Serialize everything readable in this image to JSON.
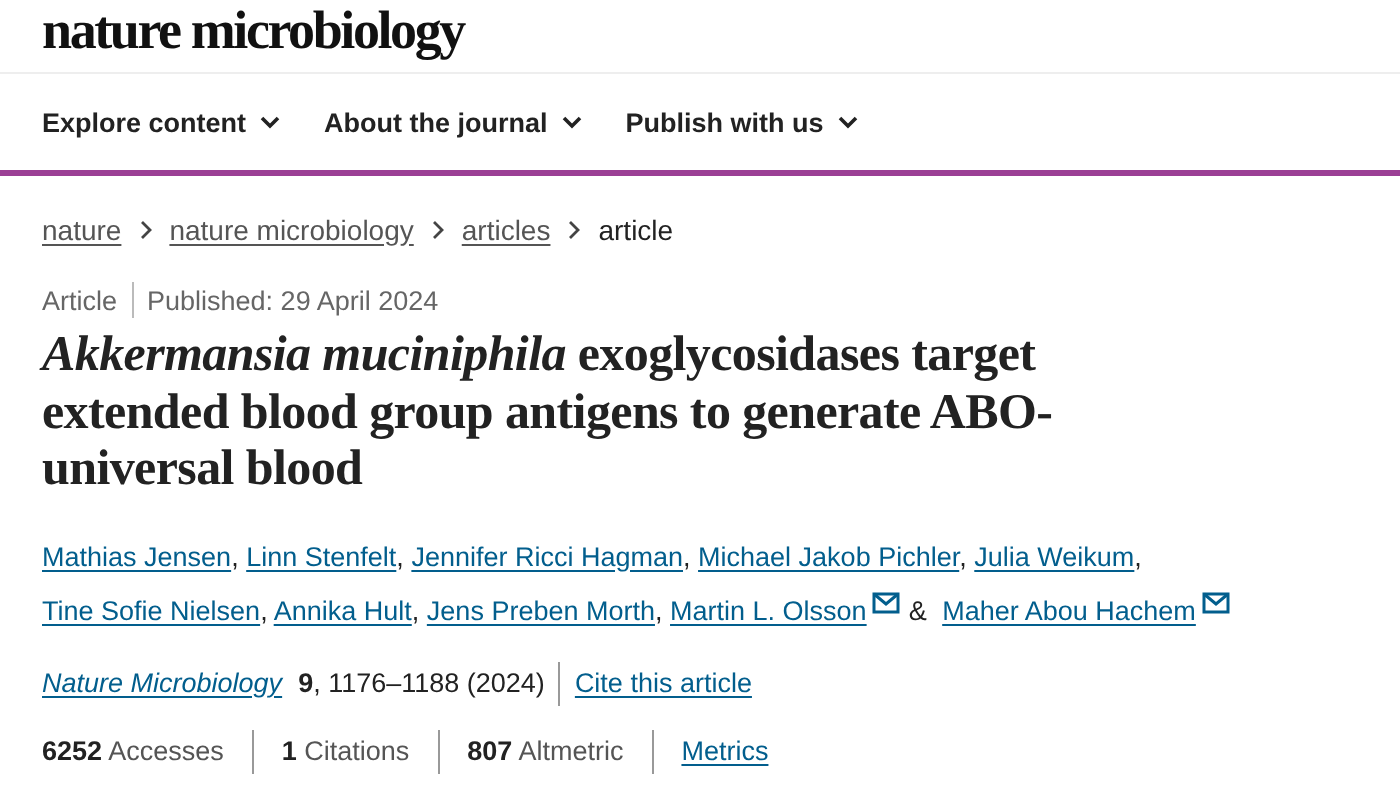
{
  "logo": "nature microbiology",
  "nav": [
    {
      "label": "Explore content",
      "caret": true
    },
    {
      "label": "About the journal",
      "caret": true
    },
    {
      "label": "Publish with us",
      "caret": true
    }
  ],
  "breadcrumb": [
    {
      "label": "nature",
      "link": true
    },
    {
      "label": "nature microbiology",
      "link": true
    },
    {
      "label": "articles",
      "link": true
    },
    {
      "label": "article",
      "link": false
    }
  ],
  "article": {
    "type": "Article",
    "published": "Published: 29 April 2024",
    "title": "*Akkermansia muciniphila* exoglycosidases target extended blood group antigens to generate ABO-universal blood",
    "authors": [
      {
        "name": "Mathias Jensen",
        "email": false,
        "separator": ","
      },
      {
        "name": "Linn Stenfelt",
        "email": false,
        "separator": ","
      },
      {
        "name": "Jennifer Ricci Hagman",
        "email": false,
        "separator": ","
      },
      {
        "name": "Michael Jakob Pichler",
        "email": false,
        "separator": ","
      },
      {
        "name": "Julia Weikum",
        "email": false,
        "separator": ","
      },
      {
        "name": "Tine Sofie Nielsen",
        "email": false,
        "separator": ","
      },
      {
        "name": "Annika Hult",
        "email": false,
        "separator": ","
      },
      {
        "name": "Jens Preben Morth",
        "email": false,
        "separator": ","
      },
      {
        "name": "Martin L. Olsson",
        "email": true,
        "separator": "&"
      },
      {
        "name": "Maher Abou Hachem",
        "email": true
      }
    ],
    "journal": "Nature Microbiology",
    "volume": "9",
    "pages": ", 1176–1188 (2024)",
    "cite": "Cite this article",
    "metrics": [
      {
        "value": "6252",
        "label": "Accesses"
      },
      {
        "value": "1",
        "label": "Citations"
      },
      {
        "value": "807",
        "label": "Altmetric"
      }
    ],
    "metrics_link": "Metrics"
  }
}
